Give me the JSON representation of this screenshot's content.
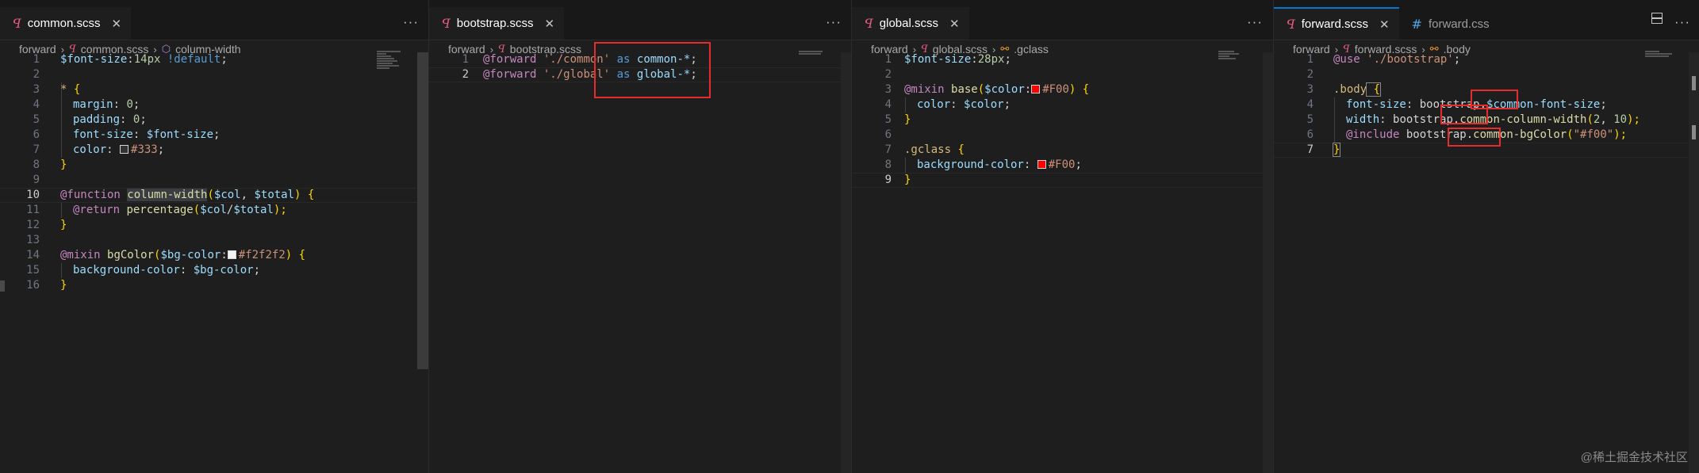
{
  "panes": [
    {
      "tabs": [
        {
          "label": "common.scss",
          "icon": "scss-icon",
          "active": true
        }
      ],
      "breadcrumb": [
        "forward",
        "common.scss",
        "column-width"
      ],
      "lines": [
        "1",
        "2",
        "3",
        "4",
        "5",
        "6",
        "7",
        "8",
        "9",
        "10",
        "11",
        "12",
        "13",
        "14",
        "15",
        "16"
      ]
    },
    {
      "tabs": [
        {
          "label": "bootstrap.scss",
          "icon": "scss-icon",
          "active": true
        }
      ],
      "breadcrumb": [
        "forward",
        "bootstrap.scss"
      ],
      "lines": [
        "1",
        "2"
      ]
    },
    {
      "tabs": [
        {
          "label": "global.scss",
          "icon": "scss-icon",
          "active": true
        }
      ],
      "breadcrumb": [
        "forward",
        "global.scss",
        ".gclass"
      ],
      "lines": [
        "1",
        "2",
        "3",
        "4",
        "5",
        "6",
        "7",
        "8",
        "9"
      ]
    },
    {
      "tabs": [
        {
          "label": "forward.scss",
          "icon": "scss-icon",
          "active": true
        },
        {
          "label": "forward.css",
          "icon": "css-icon",
          "active": false
        }
      ],
      "breadcrumb": [
        "forward",
        "forward.scss",
        ".body"
      ],
      "lines": [
        "1",
        "2",
        "3",
        "4",
        "5",
        "6",
        "7"
      ]
    }
  ],
  "code": {
    "p0": {
      "l1": [
        "$font-size",
        ":",
        "14px",
        " !default",
        ";"
      ],
      "l3": [
        "*",
        " {"
      ],
      "l4": [
        "margin",
        ": ",
        "0",
        ";"
      ],
      "l5": [
        "padding",
        ": ",
        "0",
        ";"
      ],
      "l6": [
        "font-size",
        ": ",
        "$font-size",
        ";"
      ],
      "l7": [
        "color",
        ": ",
        "#333",
        ";"
      ],
      "l8": [
        "}"
      ],
      "l10": [
        "@function",
        " ",
        "column-width",
        "(",
        "$col",
        ", ",
        "$total",
        ") {"
      ],
      "l11": [
        "@return",
        " ",
        "percentage",
        "(",
        "$col",
        "/",
        "$total",
        ");"
      ],
      "l12": [
        "}"
      ],
      "l14": [
        "@mixin",
        " ",
        "bgColor",
        "(",
        "$bg-color",
        ":",
        "#f2f2f2",
        ") {"
      ],
      "l15": [
        "background-color",
        ": ",
        "$bg-color",
        ";"
      ],
      "l16": [
        "}"
      ]
    },
    "p1": {
      "l1": [
        "@forward",
        " ",
        "'./common'",
        " as ",
        "common-*",
        ";"
      ],
      "l2": [
        "@forward",
        " ",
        "'./global'",
        " as ",
        "global-*",
        ";"
      ]
    },
    "p2": {
      "l1": [
        "$font-size",
        ":",
        "28px",
        ";"
      ],
      "l3": [
        "@mixin",
        " ",
        "base",
        "(",
        "$color",
        ":",
        "#F00",
        ") {"
      ],
      "l4": [
        "color",
        ": ",
        "$color",
        ";"
      ],
      "l5": [
        "}"
      ],
      "l7": [
        ".gclass",
        " {"
      ],
      "l8": [
        "background-color",
        ": ",
        "#F00",
        ";"
      ],
      "l9": [
        "}"
      ]
    },
    "p3": {
      "l1": [
        "@use",
        " ",
        "'./bootstrap'",
        ";"
      ],
      "l3": [
        ".body",
        " {"
      ],
      "l4": [
        "font-size",
        ": ",
        "bootstrap",
        ".",
        "$common-font-size",
        ";"
      ],
      "l5": [
        "width",
        ": ",
        "bootstrap",
        ".",
        "common-column-width",
        "(",
        "2",
        ", ",
        "10",
        ");"
      ],
      "l6": [
        "@include",
        " ",
        "bootstrap",
        ".",
        "common-bgColor",
        "(",
        "\"#f00\"",
        ");"
      ],
      "l7": [
        "}"
      ]
    }
  },
  "colors": {
    "swatch_333": "#333333",
    "swatch_f2f2f2": "#f2f2f2",
    "swatch_f00": "#ff0000",
    "annotation_box": "#e52d2d",
    "accent": "#0078d4"
  },
  "watermark": "@稀土掘金技术社区"
}
